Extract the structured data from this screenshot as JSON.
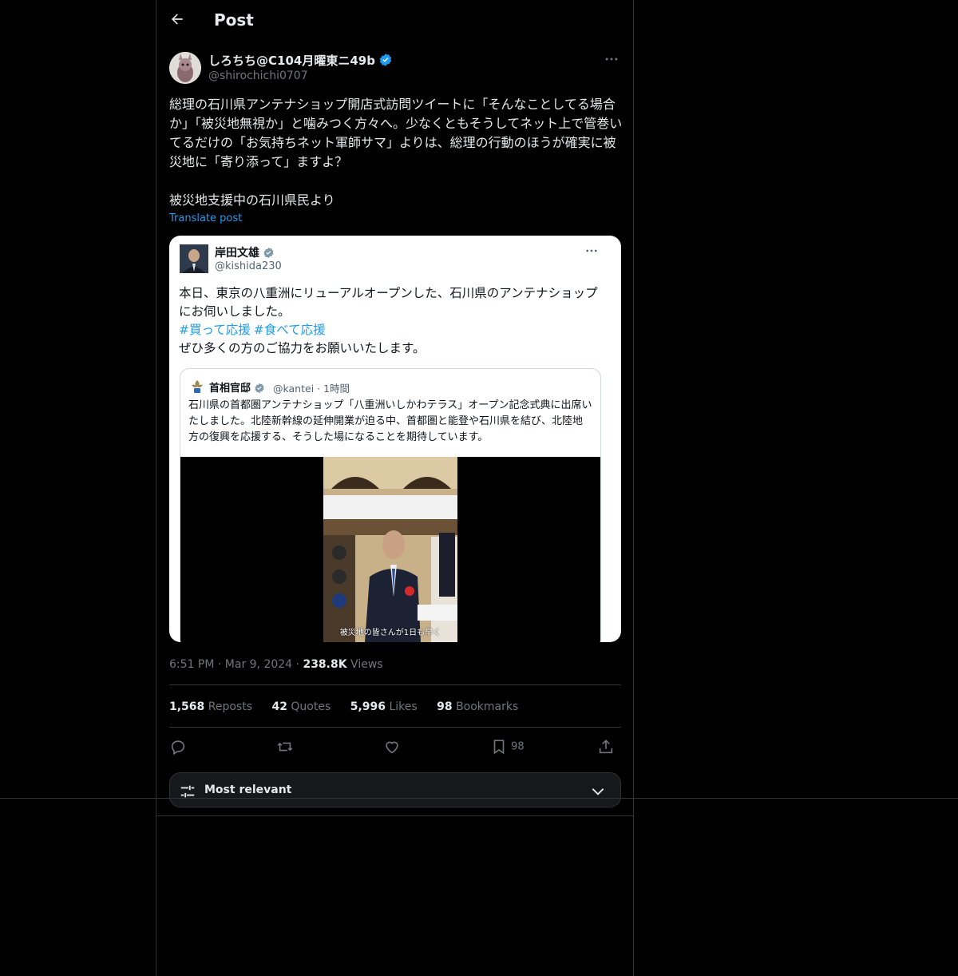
{
  "header": {
    "title": "Post"
  },
  "author": {
    "name": "しろちち@C104月曜東ニ49b",
    "handle": "@shirochichi0707",
    "verified": true
  },
  "post": {
    "lines": [
      "総理の石川県アンテナショップ開店式訪問ツイートに「そんなことしてる場合か」「被災地無視か」と噛みつく方々へ。少なくともそうしてネット上で管巻いてるだけの「お気持ちネット軍師サマ」よりは、総理の行動のほうが確実に被災地に「寄り添って」ますよ？",
      "被災地支援中の石川県民より"
    ],
    "translate_label": "Translate post"
  },
  "embed": {
    "name": "岸田文雄",
    "handle": "@kishida230",
    "text_line1": "本日、東京の八重洲にリューアルオープンした、石川県のアンテナショップにお伺いしました。",
    "hashtags": [
      "#買って応援",
      "#食べて応援"
    ],
    "text_line3": "ぜひ多くの方のご協力をお願いいたします。",
    "quote": {
      "name": "首相官邸",
      "handle": "@kantei",
      "time": "1時間",
      "text": "石川県の首都圏アンテナショップ「八重洲いしかわテラス」オープン記念式典に出席いたしました。北陸新幹線の延伸開業が迫る中、首都圏と能登や石川県を結び、北陸地方の復興を応援する、そうした場になることを期待しています。",
      "caption": "被災地の皆さんが1日も早く"
    }
  },
  "meta": {
    "time": "6:51 PM",
    "date": "Mar 9, 2024",
    "views_count": "238.8K",
    "views_label": "Views"
  },
  "stats": {
    "reposts_count": "1,568",
    "reposts_label": "Reposts",
    "quotes_count": "42",
    "quotes_label": "Quotes",
    "likes_count": "5,996",
    "likes_label": "Likes",
    "bookmarks_count": "98",
    "bookmarks_label": "Bookmarks"
  },
  "actions": {
    "bookmark_count": "98"
  },
  "sort": {
    "label": "Most relevant"
  },
  "icons": [
    "back-arrow-icon",
    "verified-badge-icon",
    "more-icon",
    "reply-icon",
    "repost-icon",
    "like-icon",
    "bookmark-icon",
    "share-icon",
    "sort-icon",
    "chevron-down-icon"
  ],
  "colors": {
    "background": "#000000",
    "accent": "#1d9bf0",
    "border": "#2f3336",
    "muted": "#71767b"
  }
}
